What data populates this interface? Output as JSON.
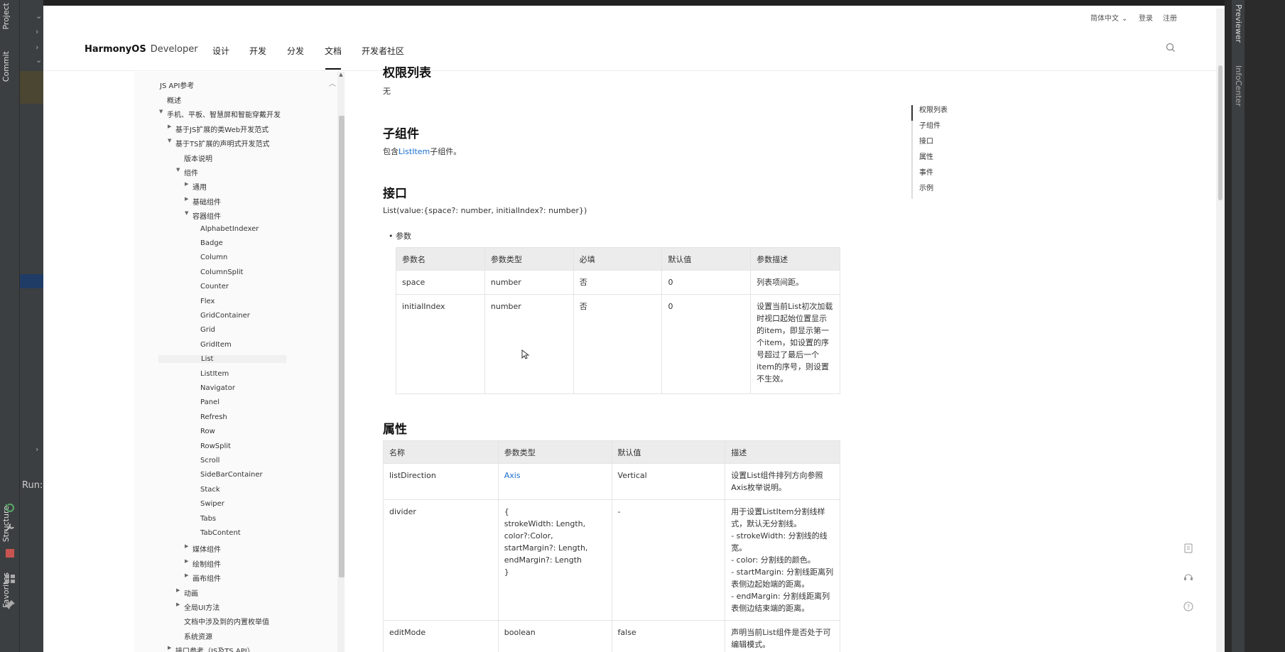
{
  "ide": {
    "left_tabs": {
      "project": "Project",
      "commit": "Commit",
      "structure": "Structure",
      "favorites": "Favorites"
    },
    "run_label": "Run:",
    "right_tabs": {
      "previewer": "Previewer",
      "infocenter": "InfoCenter"
    }
  },
  "util": {
    "lang": "简体中文",
    "login": "登录",
    "register": "注册"
  },
  "nav": {
    "brand_bold": "HarmonyOS",
    "brand_sub": "Developer",
    "items": [
      "设计",
      "开发",
      "分发",
      "文档",
      "开发者社区"
    ]
  },
  "sidebar": {
    "section_title": "JS API参考",
    "items": [
      {
        "label": "概述",
        "level": 1
      },
      {
        "label": "手机、平板、智慧屏和智能穿戴开发",
        "level": 1,
        "expanded": true
      },
      {
        "label": "基于JS扩展的类Web开发范式",
        "level": 2,
        "expanded": false
      },
      {
        "label": "基于TS扩展的声明式开发范式",
        "level": 2,
        "expanded": true
      },
      {
        "label": "版本说明",
        "level": 3
      },
      {
        "label": "组件",
        "level": 3,
        "expanded": true
      },
      {
        "label": "通用",
        "level": 4,
        "expanded": false
      },
      {
        "label": "基础组件",
        "level": 4,
        "expanded": false
      },
      {
        "label": "容器组件",
        "level": 4,
        "expanded": true
      },
      {
        "label": "AlphabetIndexer",
        "level": 5
      },
      {
        "label": "Badge",
        "level": 5
      },
      {
        "label": "Column",
        "level": 5
      },
      {
        "label": "ColumnSplit",
        "level": 5
      },
      {
        "label": "Counter",
        "level": 5
      },
      {
        "label": "Flex",
        "level": 5
      },
      {
        "label": "GridContainer",
        "level": 5
      },
      {
        "label": "Grid",
        "level": 5
      },
      {
        "label": "GridItem",
        "level": 5
      },
      {
        "label": "List",
        "level": 5,
        "selected": true
      },
      {
        "label": "ListItem",
        "level": 5
      },
      {
        "label": "Navigator",
        "level": 5
      },
      {
        "label": "Panel",
        "level": 5
      },
      {
        "label": "Refresh",
        "level": 5
      },
      {
        "label": "Row",
        "level": 5
      },
      {
        "label": "RowSplit",
        "level": 5
      },
      {
        "label": "Scroll",
        "level": 5
      },
      {
        "label": "SideBarContainer",
        "level": 5
      },
      {
        "label": "Stack",
        "level": 5
      },
      {
        "label": "Swiper",
        "level": 5
      },
      {
        "label": "Tabs",
        "level": 5
      },
      {
        "label": "TabContent",
        "level": 5
      },
      {
        "label": "媒体组件",
        "level": 4,
        "expanded": false
      },
      {
        "label": "绘制组件",
        "level": 4,
        "expanded": false
      },
      {
        "label": "画布组件",
        "level": 4,
        "expanded": false
      },
      {
        "label": "动画",
        "level": 3,
        "expanded": false
      },
      {
        "label": "全局UI方法",
        "level": 3,
        "expanded": false
      },
      {
        "label": "文档中涉及到的内置枚举值",
        "level": 3
      },
      {
        "label": "系统资源",
        "level": 3
      },
      {
        "label": "接口参考（JS及TS API）",
        "level": 2,
        "expanded": false
      }
    ]
  },
  "content": {
    "perm_title": "权限列表",
    "perm_text": "无",
    "child_title": "子组件",
    "child_prefix": "包含",
    "child_link": "ListItem",
    "child_suffix": "子组件。",
    "api_title": "接口",
    "api_signature": "List(value:{space?: number, initialIndex?: number})",
    "params_bullet": "参数",
    "params_headers": [
      "参数名",
      "参数类型",
      "必填",
      "默认值",
      "参数描述"
    ],
    "params_rows": [
      [
        "space",
        "number",
        "否",
        "0",
        "列表项间距。"
      ],
      [
        "initialIndex",
        "number",
        "否",
        "0",
        "设置当前List初次加载时视口起始位置显示的item，即显示第一个item，如设置的序号超过了最后一个item的序号，则设置不生效。"
      ]
    ],
    "attr_title": "属性",
    "attr_headers": [
      "名称",
      "参数类型",
      "默认值",
      "描述"
    ],
    "attr_rows": [
      {
        "name": "listDirection",
        "type": "Axis",
        "type_link": true,
        "default": "Vertical",
        "desc": [
          "设置List组件排列方向参照Axis枚举说明。"
        ]
      },
      {
        "name": "divider",
        "type": "{\nstrokeWidth: Length,\ncolor?:Color,\nstartMargin?: Length,\nendMargin?: Length\n}",
        "type_link": false,
        "default": "-",
        "desc": [
          "用于设置ListItem分割线样式，默认无分割线。",
          "- strokeWidth: 分割线的线宽。",
          "- color: 分割线的颜色。",
          "- startMargin: 分割线距离列表侧边起始端的距离。",
          "- endMargin: 分割线距离列表侧边结束端的距离。"
        ]
      },
      {
        "name": "editMode",
        "type": "boolean",
        "type_link": false,
        "default": "false",
        "desc": [
          "声明当前List组件是否处于可编辑模式。"
        ]
      }
    ]
  },
  "toc": [
    "权限列表",
    "子组件",
    "接口",
    "属性",
    "事件",
    "示例"
  ]
}
